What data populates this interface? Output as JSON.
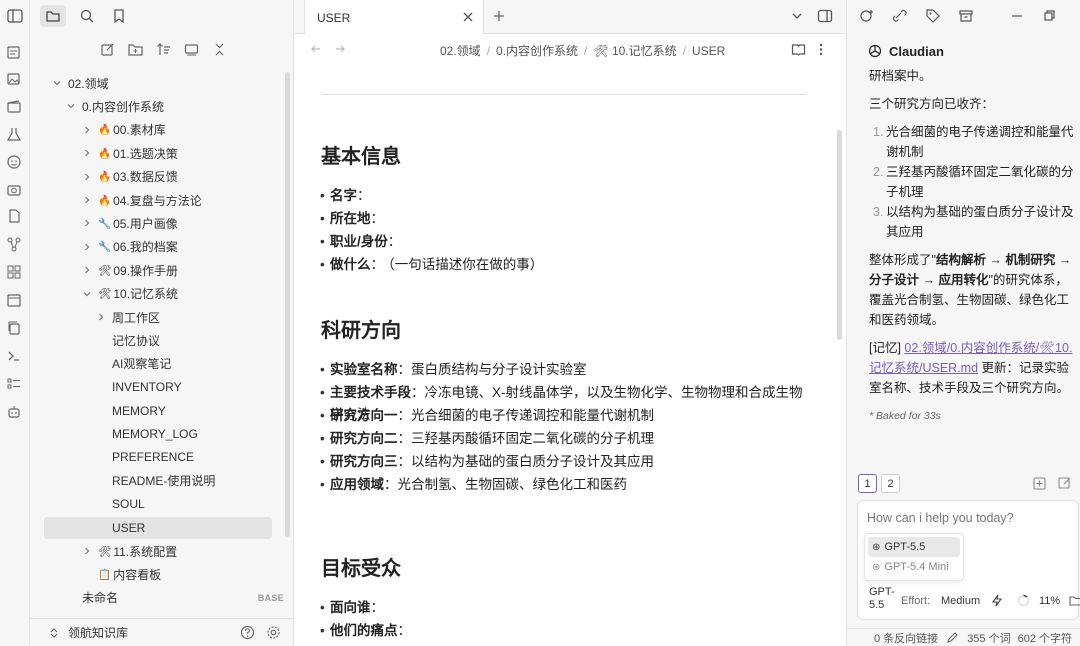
{
  "sidebar": {
    "tree": [
      {
        "label": "02.领域",
        "level": 0,
        "chevron": "down"
      },
      {
        "label": "0.内容创作系统",
        "level": 1,
        "chevron": "down"
      },
      {
        "emoji": "🔥",
        "label": "00.素材库",
        "level": 2,
        "chevron": "right"
      },
      {
        "emoji": "🔥",
        "label": "01.选题决策",
        "level": 2,
        "chevron": "right"
      },
      {
        "emoji": "🔥",
        "label": "03.数据反馈",
        "level": 2,
        "chevron": "right"
      },
      {
        "emoji": "🔥",
        "label": "04.复盘与方法论",
        "level": 2,
        "chevron": "right"
      },
      {
        "emoji": "🔧",
        "label": "05.用户画像",
        "level": 2,
        "chevron": "right"
      },
      {
        "emoji": "🔧",
        "label": "06.我的档案",
        "level": 2,
        "chevron": "right"
      },
      {
        "emoji": "🛠",
        "label": "09.操作手册",
        "level": 2,
        "chevron": "right"
      },
      {
        "emoji": "🛠",
        "label": "10.记忆系统",
        "level": 2,
        "chevron": "down"
      },
      {
        "label": "周工作区",
        "level": 3,
        "chevron": "right"
      },
      {
        "label": "记忆协议",
        "level": 3
      },
      {
        "label": "AI观察笔记",
        "level": 3
      },
      {
        "label": "INVENTORY",
        "level": 3
      },
      {
        "label": "MEMORY",
        "level": 3
      },
      {
        "label": "MEMORY_LOG",
        "level": 3
      },
      {
        "label": "PREFERENCE",
        "level": 3
      },
      {
        "label": "README-使用说明",
        "level": 3
      },
      {
        "label": "SOUL",
        "level": 3
      },
      {
        "label": "USER",
        "level": 3,
        "selected": true
      },
      {
        "emoji": "🛠",
        "label": "11.系统配置",
        "level": 2,
        "chevron": "right"
      },
      {
        "emoji": "📋",
        "label": "内容看板",
        "level": 2
      },
      {
        "label": "未命名",
        "level": 1,
        "badge": "BASE"
      }
    ],
    "vault_name": "领航知识库"
  },
  "editor": {
    "tab_title": "USER",
    "breadcrumb": [
      "02.领域",
      "0.内容创作系统",
      "🛠 10.记忆系统",
      "USER"
    ],
    "sections": [
      {
        "heading": "基本信息",
        "items": [
          {
            "key": "名字",
            "value": ""
          },
          {
            "key": "所在地",
            "value": ""
          },
          {
            "key": "职业/身份",
            "value": ""
          },
          {
            "key": "做什么",
            "value": "（一句话描述你在做的事）"
          }
        ]
      },
      {
        "heading": "科研方向",
        "items": [
          {
            "key": "实验室名称",
            "value": "蛋白质结构与分子设计实验室"
          },
          {
            "key": "主要技术手段",
            "value": "冷冻电镜、X-射线晶体学，以及生物化学、生物物理和合成生物学方法"
          },
          {
            "key": "研究方向一",
            "value": "光合细菌的电子传递调控和能量代谢机制"
          },
          {
            "key": "研究方向二",
            "value": "三羟基丙酸循环固定二氧化碳的分子机理"
          },
          {
            "key": "研究方向三",
            "value": "以结构为基础的蛋白质分子设计及其应用"
          },
          {
            "key": "应用领域",
            "value": "光合制氢、生物固碳、绿色化工和医药"
          }
        ]
      },
      {
        "heading": "目标受众",
        "items": [
          {
            "key": "面向谁",
            "value": ""
          },
          {
            "key": "他们的痛点",
            "value": ""
          }
        ]
      }
    ]
  },
  "chat": {
    "assistant_name": "Claudian",
    "line1": "研档案中。",
    "line2": "三个研究方向已收齐：",
    "directions": [
      "光合细菌的电子传递调控和能量代谢机制",
      "三羟基丙酸循环固定二氧化碳的分子机理",
      "以结构为基础的蛋白质分子设计及其应用"
    ],
    "summary_pre": "整体形成了\"",
    "summary_bold": "结构解析 → 机制研究 → 分子设计 → 应用转化",
    "summary_post": "\"的研究体系，覆盖光合制氢、生物固碳、绿色化工和医药领域。",
    "memory_prefix": "[记忆] ",
    "memory_link": "02.领域/0.内容创作系统/🛠10.记忆系统/USER.md",
    "memory_suffix": " 更新：记录实验室名称、技术手段及三个研究方向。",
    "baked": "* Baked for 33s",
    "convo_tabs": [
      "1",
      "2"
    ],
    "input_placeholder": "How can i help you today?",
    "model_options": [
      "GPT-5.5",
      "GPT-5.4 Mini"
    ],
    "model_current": "GPT-5.5",
    "effort_label": "Effort:",
    "effort_value": "Medium",
    "context_percent": "11%",
    "status_backlinks": "0 条反向链接",
    "status_words": "355 个词",
    "status_chars": "602 个字符"
  },
  "colors": {
    "accent": "#7a5cc7",
    "panel_bg": "#f6f6f6",
    "selected_bg": "#e3e3e3",
    "flame": "#e2572c"
  }
}
